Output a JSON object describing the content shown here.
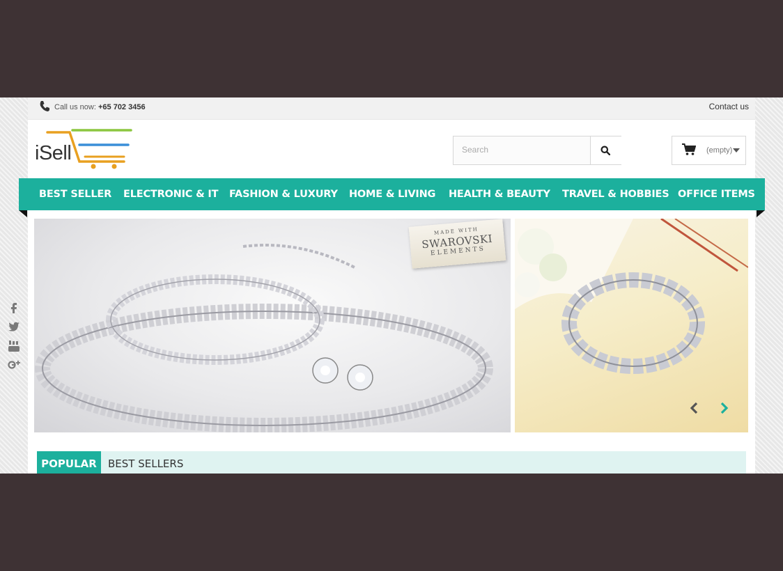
{
  "topbar": {
    "call_label": "Call us now:",
    "phone": "+65 702 3456",
    "contact_label": "Contact us"
  },
  "logo": {
    "text": "iSell"
  },
  "search": {
    "placeholder": "Search"
  },
  "cart": {
    "status": "(empty)"
  },
  "nav": {
    "items": [
      {
        "label": "BEST SELLER"
      },
      {
        "label": "ELECTRONIC & IT"
      },
      {
        "label": "FASHION & LUXURY"
      },
      {
        "label": "HOME & LIVING"
      },
      {
        "label": "HEALTH & BEAUTY"
      },
      {
        "label": "TRAVEL & HOBBIES"
      },
      {
        "label": "OFFICE ITEMS"
      }
    ]
  },
  "banner": {
    "badge_line1": "MADE WITH",
    "badge_line2": "SWAROVSKI",
    "badge_line3": "ELEMENTS"
  },
  "social": [
    "facebook-icon",
    "twitter-icon",
    "youtube-icon",
    "google-plus-icon"
  ],
  "tabs": {
    "active": "POPULAR",
    "second": "BEST SELLERS"
  },
  "colors": {
    "accent": "#1cb09d",
    "backdrop": "#3e3234",
    "tab_strip": "#dff3f1"
  }
}
